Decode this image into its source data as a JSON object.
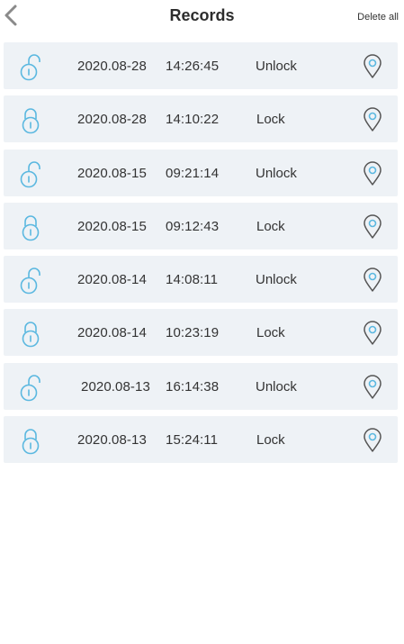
{
  "header": {
    "title": "Records",
    "delete_all_label": "Delete all",
    "back_icon": "chevron-left-icon"
  },
  "colors": {
    "row_background": "#eef2f6",
    "lock_icon": "#5bb8e0",
    "location_icon_outer": "#555555",
    "location_icon_inner": "#5bb8e0"
  },
  "records": [
    {
      "date": "2020.08-28",
      "time": "14:26:45",
      "status": "Unlock",
      "icon": "unlocked-padlock-icon"
    },
    {
      "date": "2020.08-28",
      "time": "14:10:22",
      "status": "Lock",
      "icon": "locked-padlock-icon"
    },
    {
      "date": "2020.08-15",
      "time": "09:21:14",
      "status": "Unlock",
      "icon": "unlocked-padlock-icon"
    },
    {
      "date": "2020.08-15",
      "time": "09:12:43",
      "status": "Lock",
      "icon": "locked-padlock-icon"
    },
    {
      "date": "2020.08-14",
      "time": "14:08:11",
      "status": "Unlock",
      "icon": "unlocked-padlock-icon"
    },
    {
      "date": "2020.08-14",
      "time": "10:23:19",
      "status": "Lock",
      "icon": "locked-padlock-icon"
    },
    {
      "date": "2020.08-13",
      "time": "16:14:38",
      "status": "Unlock",
      "icon": "unlocked-padlock-icon"
    },
    {
      "date": "2020.08-13",
      "time": "15:24:11",
      "status": "Lock",
      "icon": "locked-padlock-icon"
    }
  ]
}
